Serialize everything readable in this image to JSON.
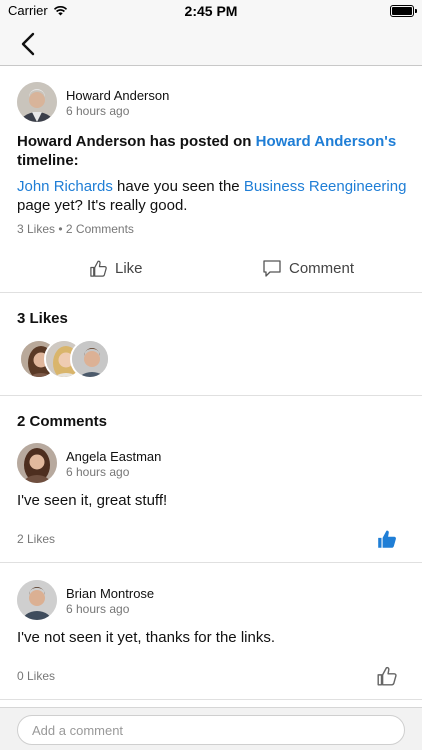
{
  "status_bar": {
    "carrier": "Carrier",
    "time": "2:45 PM"
  },
  "post": {
    "author": "Howard Anderson",
    "time": "6 hours ago",
    "headline": {
      "actor": "Howard Anderson",
      "middle": " has posted on ",
      "target": "Howard Anderson's",
      "suffix": " timeline:"
    },
    "body": {
      "mention": "John Richards",
      "text1": " have you seen the ",
      "page_link": "Business Reengineering",
      "text2": " page yet? It's really good."
    },
    "stats": "3 Likes • 2 Comments",
    "like_label": "Like",
    "comment_label": "Comment"
  },
  "likes_section": {
    "title": "3 Likes"
  },
  "comments_section": {
    "title": "2 Comments",
    "items": [
      {
        "author": "Angela Eastman",
        "time": "6 hours ago",
        "text": "I've seen it, great stuff!",
        "likes": "2 Likes",
        "liked": true
      },
      {
        "author": "Brian Montrose",
        "time": "6 hours ago",
        "text": "I've not seen it yet, thanks for the links.",
        "likes": "0 Likes",
        "liked": false
      }
    ]
  },
  "composer": {
    "placeholder": "Add a comment"
  },
  "colors": {
    "link": "#1f7ed6",
    "like_active": "#1f7ed6"
  }
}
